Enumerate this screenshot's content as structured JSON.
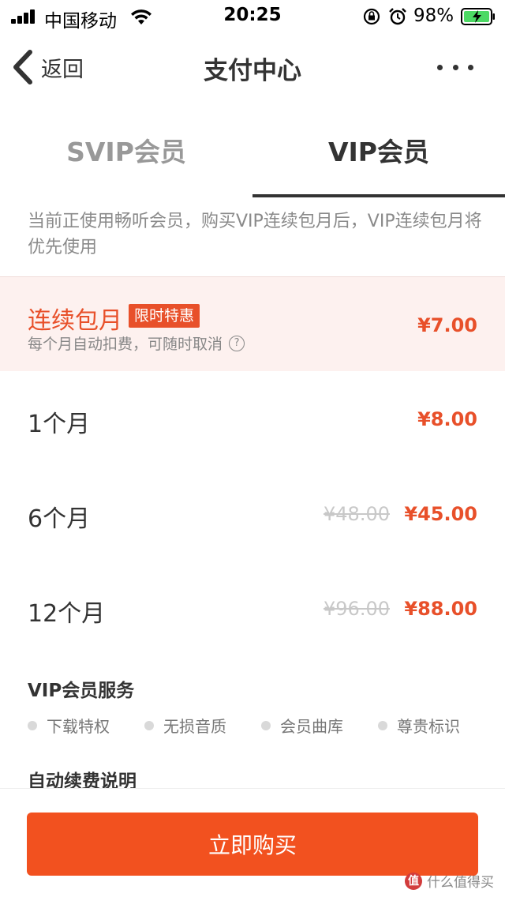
{
  "status_bar": {
    "carrier": "中国移动",
    "time": "20:25",
    "battery": "98%"
  },
  "nav": {
    "back_label": "返回",
    "title": "支付中心"
  },
  "tabs": [
    {
      "label": "SVIP会员",
      "active": false
    },
    {
      "label": "VIP会员",
      "active": true
    }
  ],
  "notice": "当前正使用畅听会员，购买VIP连续包月后，VIP连续包月将优先使用",
  "packages": {
    "auto": {
      "title": "连续包月",
      "tag": "限时特惠",
      "subtitle": "每个月自动扣费，可随时取消",
      "price": "¥7.00"
    },
    "one_month": {
      "title": "1个月",
      "price": "¥8.00"
    },
    "six_month": {
      "title": "6个月",
      "original_price": "¥48.00",
      "price": "¥45.00"
    },
    "twelve_month": {
      "title": "12个月",
      "original_price": "¥96.00",
      "price": "¥88.00"
    }
  },
  "services": {
    "title": "VIP会员服务",
    "items": [
      "下载特权",
      "无损音质",
      "会员曲库",
      "尊贵标识"
    ]
  },
  "auto_renew": {
    "title": "自动续费说明"
  },
  "buy_button": {
    "label": "立即购买"
  },
  "watermark": {
    "text": "值 什么值得买"
  },
  "colors": {
    "accent": "#f2511f",
    "price": "#e8502a",
    "selected_bg": "#fdf1ef"
  }
}
